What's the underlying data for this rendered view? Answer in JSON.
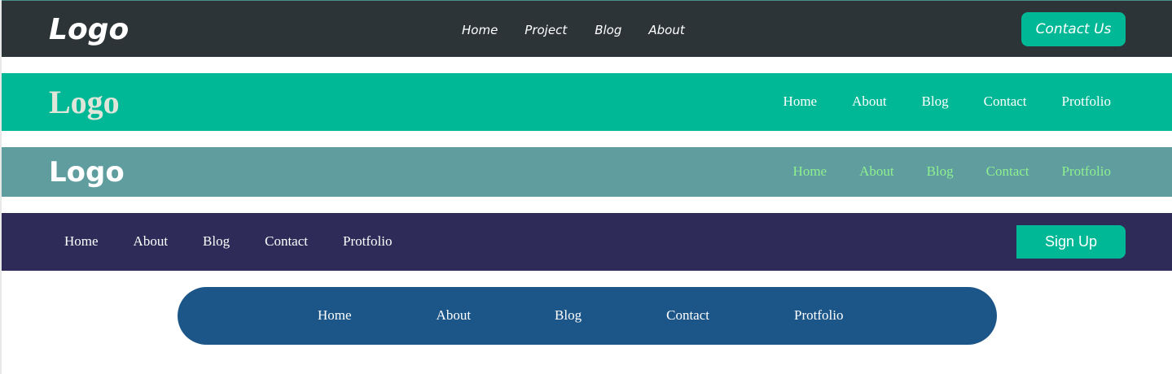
{
  "colors": {
    "nav1_background": "#2d3438",
    "nav2_background": "#00b896",
    "nav3_background": "#5f9d9f",
    "nav4_background": "#2e2b58",
    "nav5_background": "#1c5689",
    "accent_button": "#00b896",
    "nav3_link": "#8ff08f",
    "nav2_logo": "#dfe6d9"
  },
  "nav1": {
    "logo": "Logo",
    "links": [
      "Home",
      "Project",
      "Blog",
      "About"
    ],
    "cta": "Contact Us"
  },
  "nav2": {
    "logo": "Logo",
    "links": [
      "Home",
      "About",
      "Blog",
      "Contact",
      "Protfolio"
    ]
  },
  "nav3": {
    "logo": "Logo",
    "links": [
      "Home",
      "About",
      "Blog",
      "Contact",
      "Protfolio"
    ]
  },
  "nav4": {
    "links": [
      "Home",
      "About",
      "Blog",
      "Contact",
      "Protfolio"
    ],
    "cta": "Sign Up"
  },
  "nav5": {
    "links": [
      "Home",
      "About",
      "Blog",
      "Contact",
      "Protfolio"
    ]
  }
}
